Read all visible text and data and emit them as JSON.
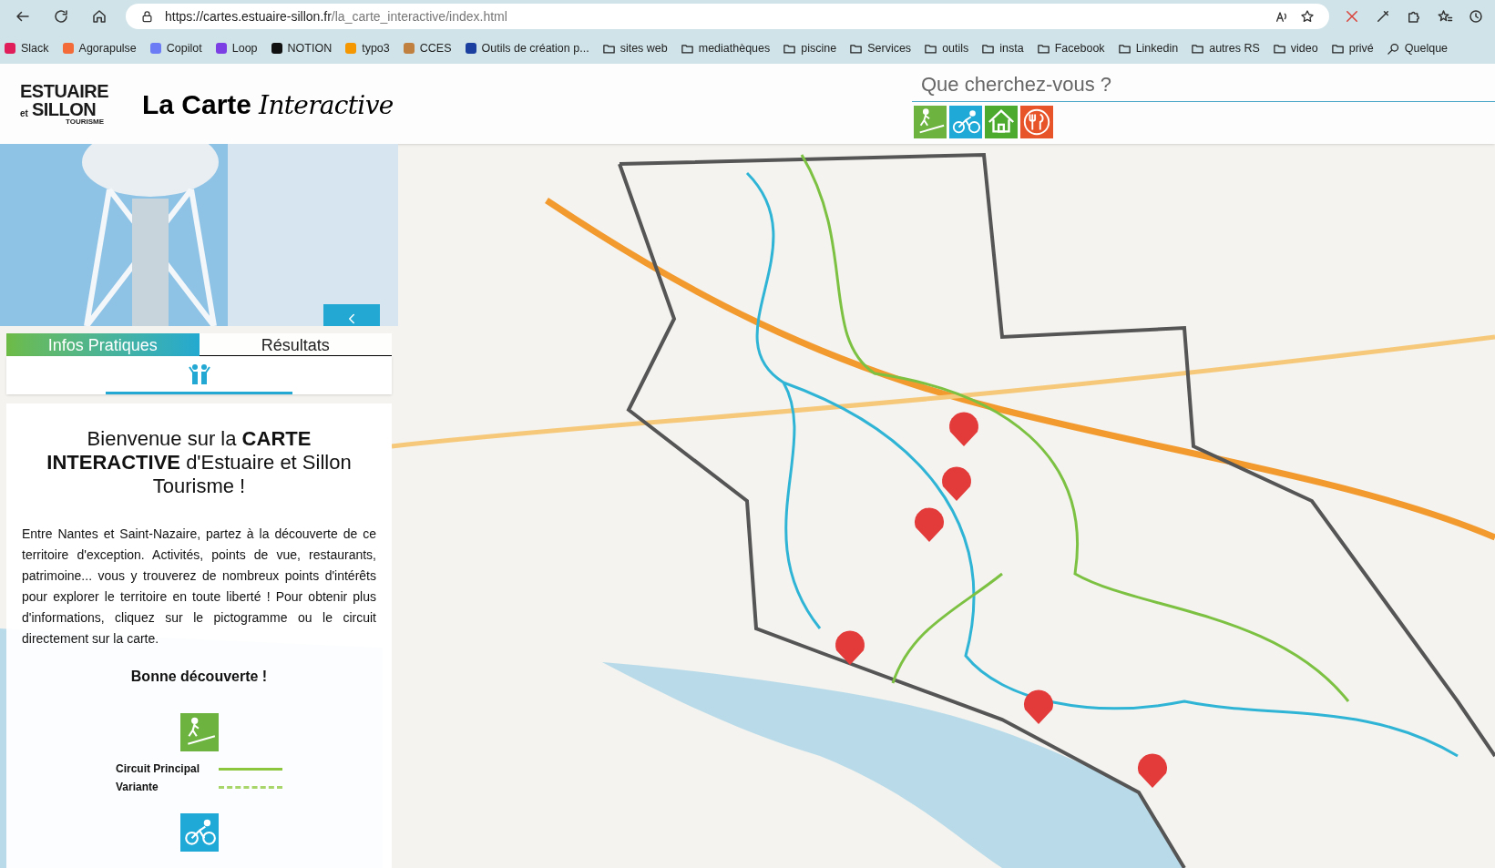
{
  "browser": {
    "url_host": "https://cartes.estuaire-sillon.fr",
    "url_path": "/la_carte_interactive/index.html",
    "bookmarks": [
      {
        "label": "Slack",
        "kind": "app",
        "color": "#e01e5a"
      },
      {
        "label": "Agorapulse",
        "kind": "app",
        "color": "#f26b38"
      },
      {
        "label": "Copilot",
        "kind": "app",
        "color": "#6b7cf5"
      },
      {
        "label": "Loop",
        "kind": "app",
        "color": "#7b3fe4"
      },
      {
        "label": "NOTION",
        "kind": "app",
        "color": "#111111"
      },
      {
        "label": "typo3",
        "kind": "app",
        "color": "#f49700"
      },
      {
        "label": "CCES",
        "kind": "app",
        "color": "#c08040"
      },
      {
        "label": "Outils de création p...",
        "kind": "app",
        "color": "#1a3f9e"
      },
      {
        "label": "sites web",
        "kind": "folder"
      },
      {
        "label": "mediathèques",
        "kind": "folder"
      },
      {
        "label": "piscine",
        "kind": "folder"
      },
      {
        "label": "Services",
        "kind": "folder"
      },
      {
        "label": "outils",
        "kind": "folder"
      },
      {
        "label": "insta",
        "kind": "folder"
      },
      {
        "label": "Facebook",
        "kind": "folder"
      },
      {
        "label": "Linkedin",
        "kind": "folder"
      },
      {
        "label": "autres RS",
        "kind": "folder"
      },
      {
        "label": "video",
        "kind": "folder"
      },
      {
        "label": "privé",
        "kind": "folder"
      },
      {
        "label": "Quelque",
        "kind": "search"
      }
    ]
  },
  "header": {
    "logo_lines": [
      "ESTUAIRE",
      "et",
      "SILLON",
      "TOURISME"
    ],
    "title_bold": "La Carte",
    "title_script": "Interactive"
  },
  "search": {
    "placeholder": "Que cherchez-vous ?"
  },
  "filters": [
    {
      "kind": "hike",
      "color": "#6db33f"
    },
    {
      "kind": "bike",
      "color": "#1fa9d6"
    },
    {
      "kind": "lodging",
      "color": "#4caa2f"
    },
    {
      "kind": "food",
      "color": "#e8542a"
    }
  ],
  "tabs": [
    {
      "label": "Infos Pratiques",
      "selected": true
    },
    {
      "label": "Résultats",
      "selected": false
    }
  ],
  "welcome": {
    "heading": "Bienvenue sur la **CARTE INTERACTIVE** d'Estuaire et Sillon Tourisme !",
    "text": "Entre Nantes et Saint-Nazaire, partez à la découverte de ce territoire d'exception. Activités, points de vue, restaurants, patrimoine... vous y trouverez de nombreux points d'intérêts pour explorer le territoire en toute liberté ! Pour obtenir plus d'informations, cliquez sur le pictogramme ou le circuit directement sur la carte.",
    "closing": "Bonne découverte !",
    "legend": [
      {
        "label": "Circuit Principal",
        "kind": "solid"
      },
      {
        "label": "Variante",
        "kind": "dashed"
      }
    ]
  }
}
